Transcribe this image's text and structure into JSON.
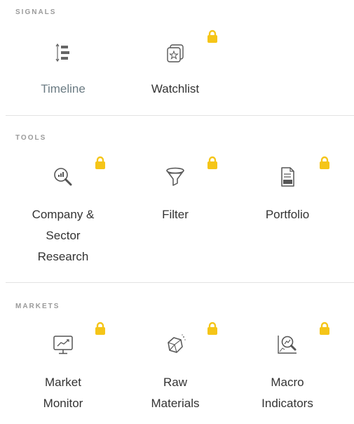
{
  "sections": {
    "signals": {
      "header": "SIGNALS",
      "items": {
        "timeline": {
          "label": "Timeline",
          "icon": "timeline-icon",
          "locked": false
        },
        "watchlist": {
          "label": "Watchlist",
          "icon": "watchlist-icon",
          "locked": true
        }
      }
    },
    "tools": {
      "header": "TOOLS",
      "items": {
        "company": {
          "label_lines": [
            "Company &",
            "Sector",
            "Research"
          ],
          "icon": "research-icon",
          "locked": true
        },
        "filter": {
          "label": "Filter",
          "icon": "filter-icon",
          "locked": true
        },
        "portfolio": {
          "label": "Portfolio",
          "icon": "portfolio-icon",
          "locked": true
        }
      }
    },
    "markets": {
      "header": "MARKETS",
      "items": {
        "market_monitor": {
          "label_lines": [
            "Market",
            "Monitor"
          ],
          "icon": "market-monitor-icon",
          "locked": true
        },
        "raw_materials": {
          "label_lines": [
            "Raw",
            "Materials"
          ],
          "icon": "raw-materials-icon",
          "locked": true
        },
        "macro": {
          "label_lines": [
            "Macro",
            "Indicators"
          ],
          "icon": "macro-indicators-icon",
          "locked": true
        }
      }
    }
  },
  "colors": {
    "lock": "#f5c518",
    "header": "#9a9a9a",
    "text": "#333333",
    "muted_text": "#6b7b83",
    "icon": "#555555"
  }
}
